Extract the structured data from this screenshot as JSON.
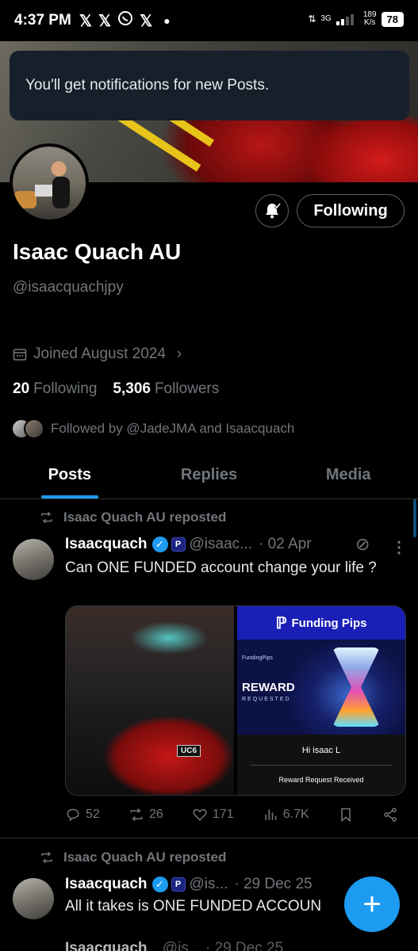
{
  "status_bar": {
    "time": "4:37 PM",
    "app_icons": [
      "X",
      "X",
      "whatsapp",
      "X"
    ],
    "network": "3G",
    "speed_value": "189",
    "speed_unit": "K/s",
    "battery": "78"
  },
  "toast": {
    "text": "You'll get notifications for new Posts."
  },
  "profile": {
    "name": "Isaac Quach AU",
    "handle": "@isaacquachjpy",
    "joined": "Joined August 2024",
    "following_count": "20",
    "following_label": "Following",
    "followers_count": "5,306",
    "followers_label": "Followers",
    "followed_by": "Followed by @JadeJMA and Isaacquach",
    "follow_button": "Following"
  },
  "tabs": [
    {
      "label": "Posts",
      "active": true
    },
    {
      "label": "Replies",
      "active": false
    },
    {
      "label": "Media",
      "active": false
    }
  ],
  "posts": [
    {
      "repost_label": "Isaac Quach AU reposted",
      "author": "Isaacquach",
      "handle": "@isaac...",
      "date": "· 02 Apr",
      "text": "Can ONE FUNDED account change your life ?",
      "media": {
        "plate": "UC6",
        "brand": "Funding Pips",
        "brand_small": "FundingPips",
        "reward_title": "REWARD",
        "reward_sub": "REQUESTED",
        "greeting": "Hi isaac L",
        "confirmation": "Reward Request Received"
      },
      "stats": {
        "replies": "52",
        "reposts": "26",
        "likes": "171",
        "views": "6.7K"
      }
    },
    {
      "repost_label": "Isaac Quach AU reposted",
      "author": "Isaacquach",
      "handle": "@is...",
      "date": "· 29 Dec 25",
      "text": "All it takes is ONE FUNDED ACCOUN"
    }
  ],
  "partial_row": {
    "name": "Isaacquach",
    "meta": "@is...  · 29 Dec 25"
  },
  "icons": {
    "bell": "bell-check-icon",
    "calendar": "calendar-icon",
    "grok": "grok-icon",
    "compose": "plus-icon"
  },
  "colors": {
    "accent": "#1d9bf0",
    "muted": "#71767b",
    "background": "#000000",
    "toast_bg": "#15202b"
  }
}
